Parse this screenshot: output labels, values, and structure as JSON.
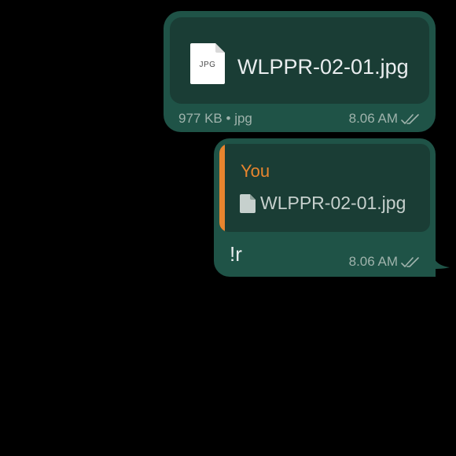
{
  "messages": [
    {
      "type": "document",
      "file_name": "WLPPR-02-01.jpg",
      "file_icon_label": "JPG",
      "file_size": "977 KB",
      "separator": "•",
      "file_type": "jpg",
      "time": "8.06 AM",
      "status_icon": "double-check-read-icon"
    },
    {
      "type": "reply",
      "quoted": {
        "author": "You",
        "file_icon": "document-icon",
        "file_name": "WLPPR-02-01.jpg"
      },
      "text": "!r",
      "time": "8.06 AM",
      "status_icon": "double-check-read-icon"
    }
  ],
  "colors": {
    "background": "#000000",
    "outgoing_bubble": "#1f5347",
    "inner_card": "#1a3d35",
    "reply_accent": "#e8852e",
    "meta_text": "#9fb3ac"
  }
}
